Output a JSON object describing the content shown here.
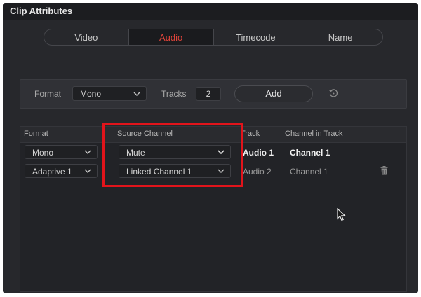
{
  "window": {
    "title": "Clip Attributes"
  },
  "tabs": [
    {
      "label": "Video",
      "active": false
    },
    {
      "label": "Audio",
      "active": true
    },
    {
      "label": "Timecode",
      "active": false
    },
    {
      "label": "Name",
      "active": false
    }
  ],
  "add_bar": {
    "format_label": "Format",
    "format_value": "Mono",
    "tracks_label": "Tracks",
    "tracks_value": "2",
    "add_button": "Add",
    "reset_icon": "reset-icon"
  },
  "table": {
    "headers": {
      "format": "Format",
      "source_channel": "Source Channel",
      "track": "Track",
      "channel_in_track": "Channel in Track"
    },
    "rows": [
      {
        "format": "Mono",
        "source_channel": "Mute",
        "track": "Audio 1",
        "channel_in_track": "Channel 1",
        "highlighted": true
      },
      {
        "format": "Adaptive 1",
        "source_channel": "Linked Channel 1",
        "track": "Audio 2",
        "channel_in_track": "Channel 1",
        "highlighted": false,
        "delete_icon": "trash-icon"
      }
    ]
  },
  "colors": {
    "active_tab_text": "#e0443a",
    "highlight_box": "#e2141b",
    "window_bg": "#27282c"
  }
}
